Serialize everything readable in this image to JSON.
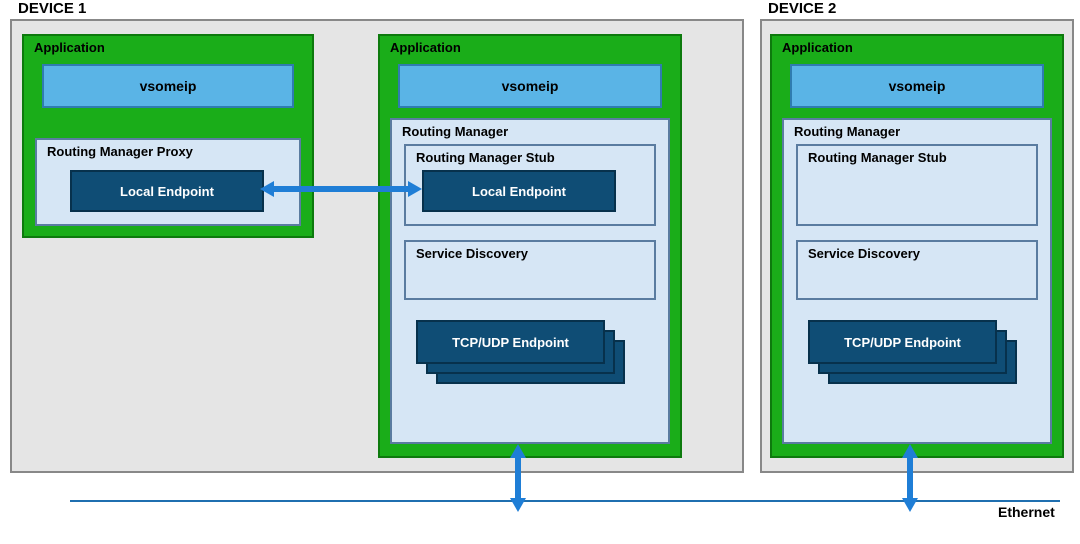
{
  "devices": {
    "device1": {
      "label": "DEVICE 1"
    },
    "device2": {
      "label": "DEVICE 2"
    }
  },
  "labels": {
    "application": "Application",
    "vsomeip": "vsomeip",
    "routing_manager": "Routing Manager",
    "routing_manager_proxy": "Routing Manager Proxy",
    "routing_manager_stub": "Routing Manager Stub",
    "local_endpoint": "Local Endpoint",
    "service_discovery": "Service Discovery",
    "tcp_udp_endpoint": "TCP/UDP Endpoint",
    "ethernet": "Ethernet"
  }
}
